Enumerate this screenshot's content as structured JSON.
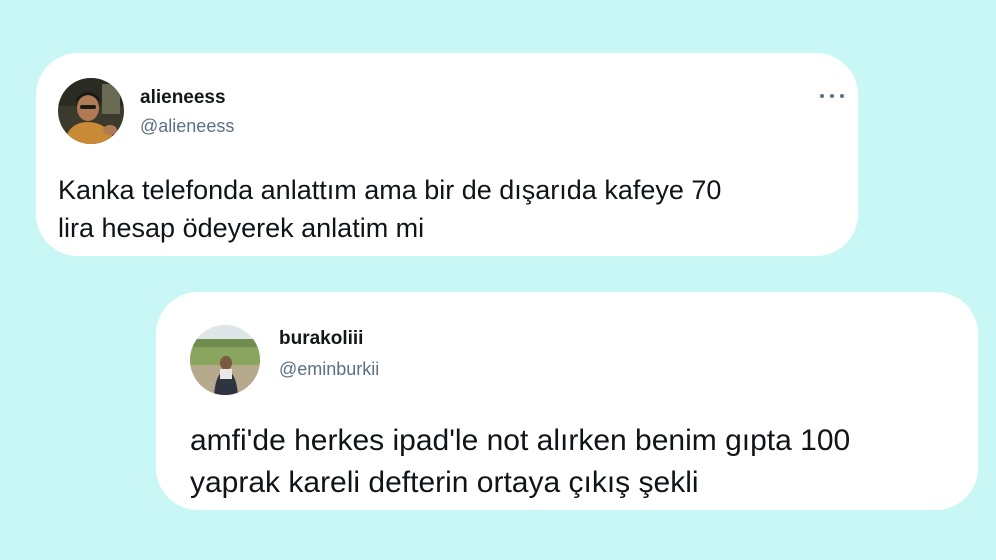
{
  "tweets": [
    {
      "name": "alieneess",
      "handle": "@alieneess",
      "text": "Kanka telefonda anlattım ama bir de dışarıda kafeye 70\nlira hesap ödeyerek anlatim mi",
      "more_icon": "more-horizontal-icon"
    },
    {
      "name": "burakoliii",
      "handle": "@eminburkii",
      "text": "amfi'de herkes ipad'le not alırken benim gıpta 100\nyaprak kareli defterin ortaya çıkış şekli"
    }
  ]
}
